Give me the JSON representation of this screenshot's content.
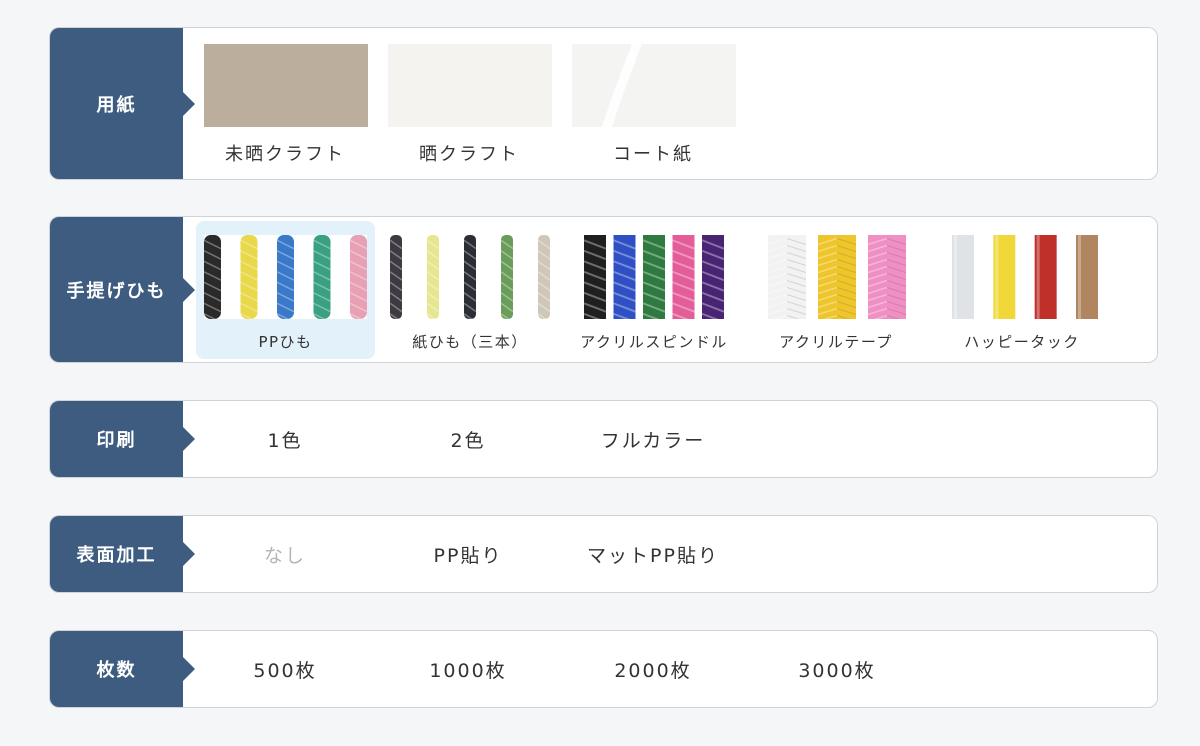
{
  "paper": {
    "label": "用紙",
    "options": [
      {
        "name": "未晒クラフト",
        "color": "#bcae9c"
      },
      {
        "name": "晒クラフト",
        "color": "#f4f3ef"
      },
      {
        "name": "コート紙",
        "color": "#f4f4f2"
      }
    ]
  },
  "handle": {
    "label": "手提げひも",
    "options": [
      {
        "name": "PPひも",
        "selected": true,
        "colors": [
          "#2a2a2a",
          "#e8d84a",
          "#3a78c9",
          "#3aa082",
          "#e8a1b4"
        ]
      },
      {
        "name": "紙ひも（三本）",
        "colors": [
          "#3e3a42",
          "#e6e690",
          "#2b2f35",
          "#6a9d5a",
          "#cfc8b8"
        ]
      },
      {
        "name": "アクリルスピンドル",
        "colors": [
          "#1f1f1f",
          "#2f4fc4",
          "#2e7a40",
          "#e35d98",
          "#4a2474"
        ]
      },
      {
        "name": "アクリルテープ",
        "colors": [
          "#f2f2f2",
          "#efc52c",
          "#ef8fc4"
        ]
      },
      {
        "name": "ハッピータック",
        "colors": [
          "#dfe3e8",
          "#f0d83a",
          "#c0302a",
          "#b08560"
        ]
      }
    ]
  },
  "print": {
    "label": "印刷",
    "options": [
      "1色",
      "2色",
      "フルカラー"
    ]
  },
  "surface": {
    "label": "表面加工",
    "options": [
      {
        "name": "なし",
        "disabled": true
      },
      {
        "name": "PP貼り",
        "disabled": false
      },
      {
        "name": "マットPP貼り",
        "disabled": false
      }
    ]
  },
  "quantity": {
    "label": "枚数",
    "options": [
      "500枚",
      "1000枚",
      "2000枚",
      "3000枚"
    ]
  },
  "colors": {
    "label_bg": "#3d5c80",
    "selected_bg": "#e3f1fb",
    "disabled_text": "#b5b5b5"
  }
}
